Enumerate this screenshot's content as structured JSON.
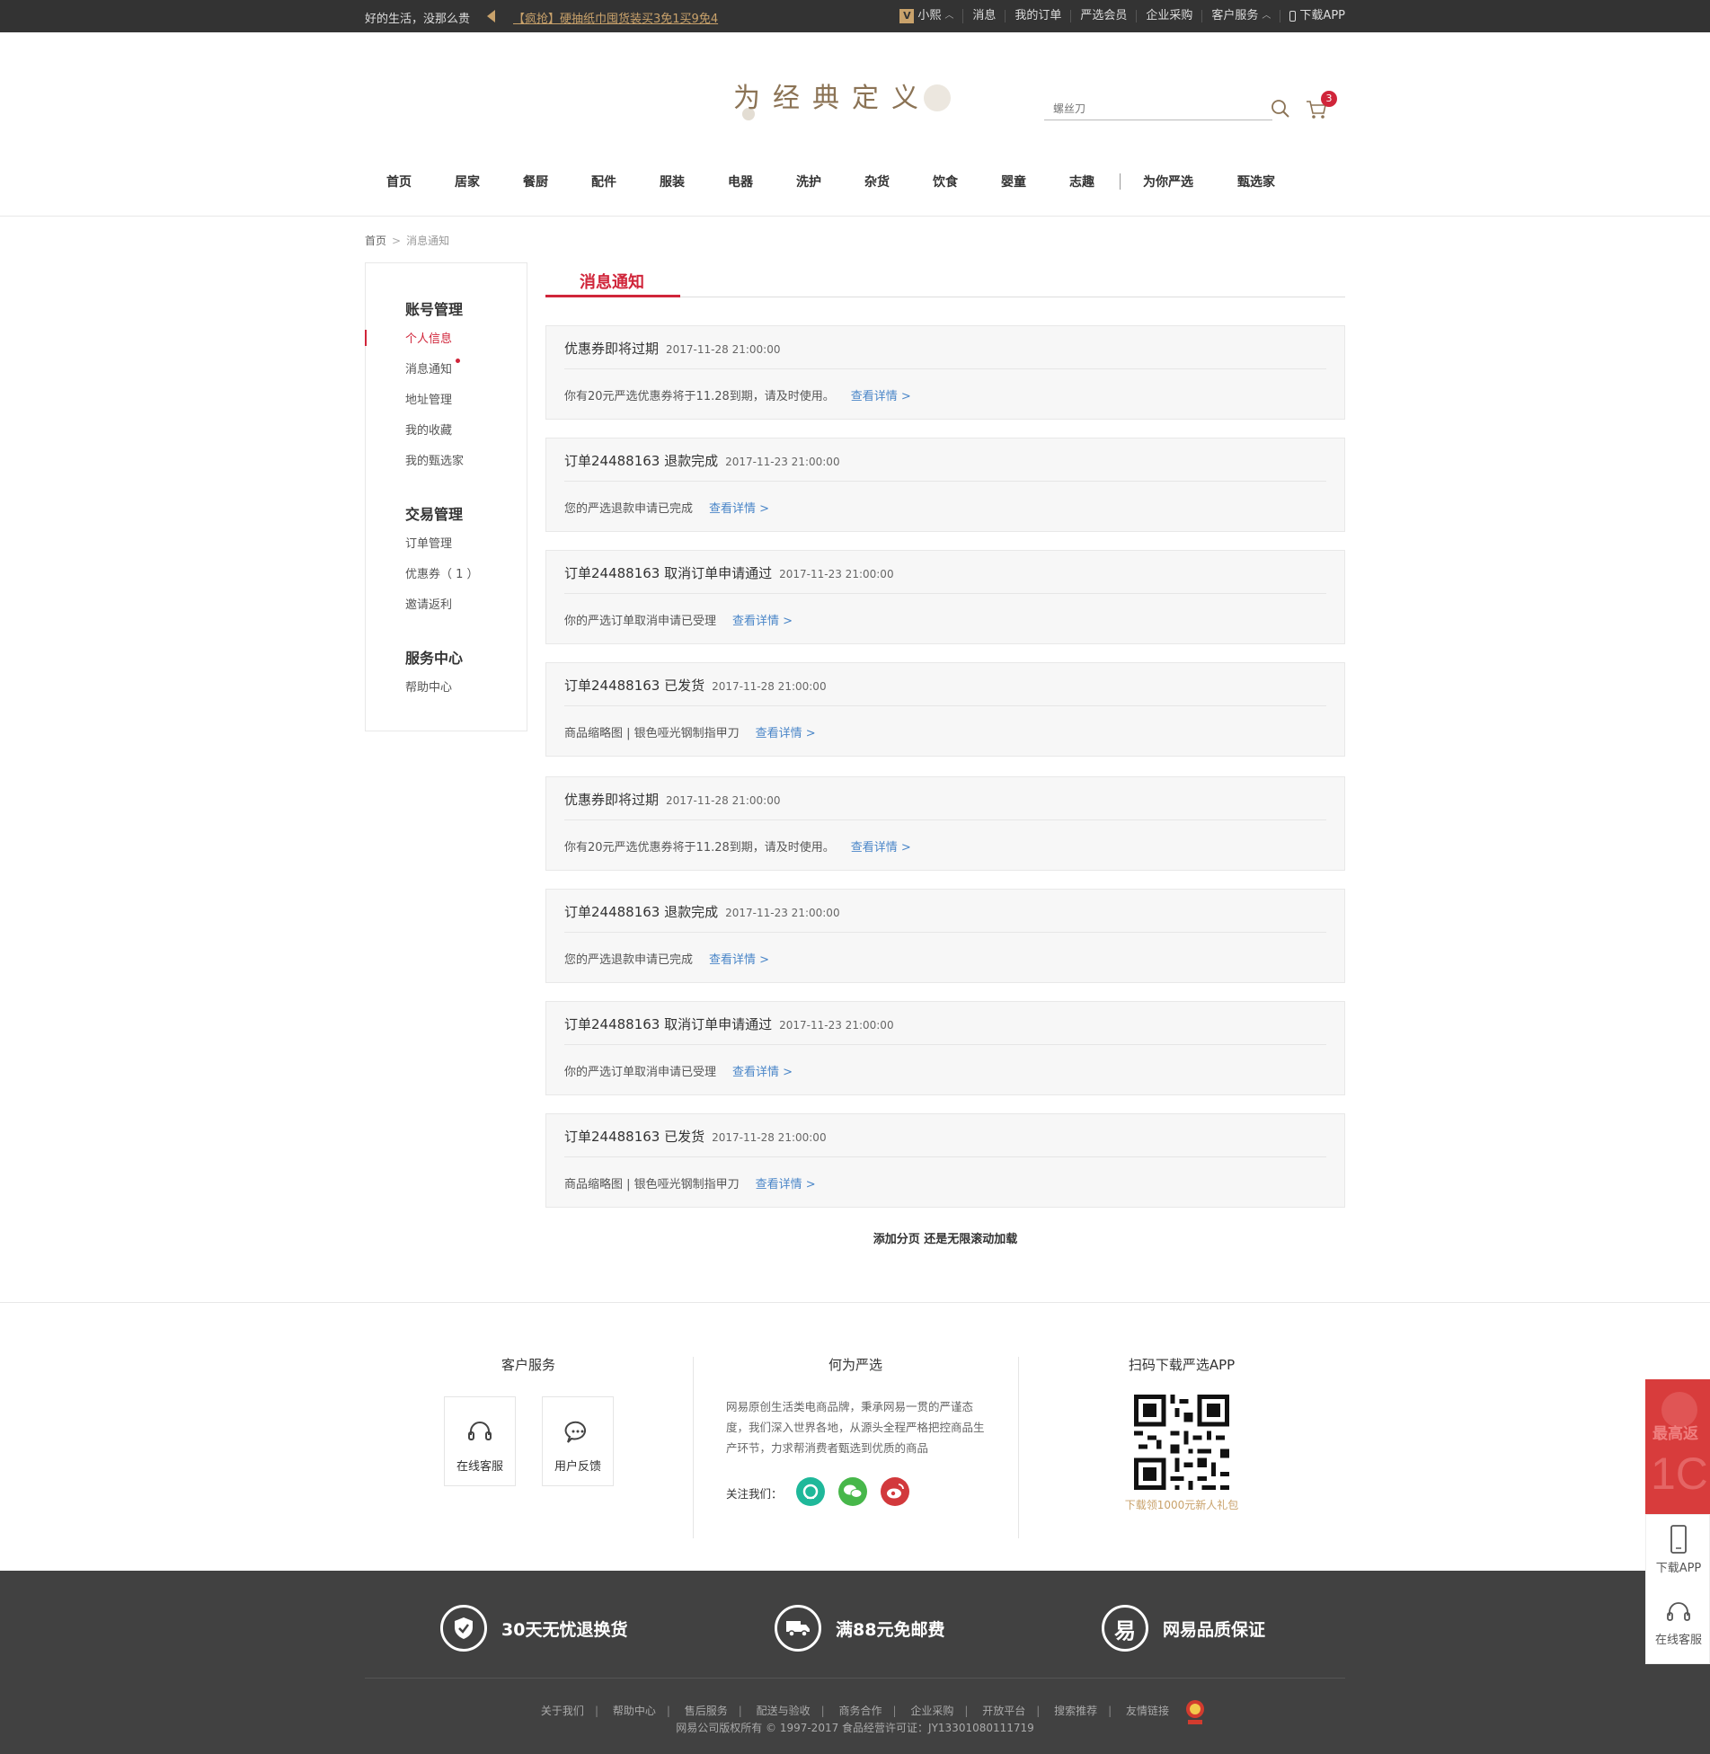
{
  "topbar": {
    "slogan": "好的生活，没那么贵",
    "promo": "【疯抢】硬抽纸巾囤货装买3免1买9免4",
    "vip_badge": "V",
    "user": "小熙",
    "messages": "消息",
    "orders": "我的订单",
    "member": "严选会员",
    "enterprise": "企业采购",
    "service": "客户服务",
    "download": "下载APP"
  },
  "header": {
    "logo": "为经典定义",
    "search_placeholder": "螺丝刀",
    "cart_count": "3"
  },
  "nav": {
    "items": [
      "首页",
      "居家",
      "餐厨",
      "配件",
      "服装",
      "电器",
      "洗护",
      "杂货",
      "饮食",
      "婴童",
      "志趣"
    ],
    "extra": [
      "为你严选",
      "甄选家"
    ]
  },
  "breadcrumb": {
    "home": "首页",
    "current": "消息通知"
  },
  "sidebar": {
    "account_title": "账号管理",
    "account_items": [
      "个人信息",
      "消息通知",
      "地址管理",
      "我的收藏",
      "我的甄选家"
    ],
    "trade_title": "交易管理",
    "trade_items": [
      "订单管理",
      "优惠券（ 1 ）",
      "邀请返利"
    ],
    "service_title": "服务中心",
    "service_items": [
      "帮助中心"
    ]
  },
  "main": {
    "tab": "消息通知",
    "link_label": "查看详情 >",
    "messages": [
      {
        "title": "优惠券即将过期",
        "time": "2017-11-28 21:00:00",
        "body": "你有20元严选优惠券将于11.28到期，请及时使用。"
      },
      {
        "title": "订单24488163 退款完成",
        "time": "2017-11-23 21:00:00",
        "body": "您的严选退款申请已完成"
      },
      {
        "title": "订单24488163 取消订单申请通过",
        "time": "2017-11-23 21:00:00",
        "body": "你的严选订单取消申请已受理"
      },
      {
        "title": "订单24488163 已发货",
        "time": "2017-11-28 21:00:00",
        "body": "商品缩略图 | 银色哑光钢制指甲刀"
      },
      {
        "title": "优惠券即将过期",
        "time": "2017-11-28 21:00:00",
        "body": "你有20元严选优惠券将于11.28到期，请及时使用。"
      },
      {
        "title": "订单24488163 退款完成",
        "time": "2017-11-23 21:00:00",
        "body": "您的严选退款申请已完成"
      },
      {
        "title": "订单24488163 取消订单申请通过",
        "time": "2017-11-23 21:00:00",
        "body": "你的严选订单取消申请已受理"
      },
      {
        "title": "订单24488163 已发货",
        "time": "2017-11-28 21:00:00",
        "body": "商品缩略图 | 银色哑光钢制指甲刀"
      }
    ],
    "load_more": "添加分页 还是无限滚动加载"
  },
  "footer": {
    "customer_service": "客户服务",
    "online_service": "在线客服",
    "feedback": "用户反馈",
    "about_title": "何为严选",
    "about_text": "网易原创生活类电商品牌，秉承网易一贯的严谨态度，我们深入世界各地，从源头全程严格把控商品生产环节，力求帮消费者甄选到优质的商品",
    "follow": "关注我们：",
    "app_title": "扫码下载严选APP",
    "app_tip": "下载领1000元新人礼包",
    "promises": [
      "30天无忧退换货",
      "满88元免邮费",
      "网易品质保证"
    ],
    "links": [
      "关于我们",
      "帮助中心",
      "售后服务",
      "配送与验收",
      "商务合作",
      "企业采购",
      "开放平台",
      "搜索推荐",
      "友情链接"
    ],
    "copyright": "网易公司版权所有 © 1997-2017   食品经营许可证：JY13301080111719"
  },
  "float": {
    "promo_text": "最高返",
    "promo_num": "1C",
    "download": "下载APP",
    "online": "在线客服"
  },
  "colors": {
    "accent": "#d0253a",
    "link": "#4a86c8",
    "gold": "#c9a26b",
    "dark": "#333333"
  }
}
